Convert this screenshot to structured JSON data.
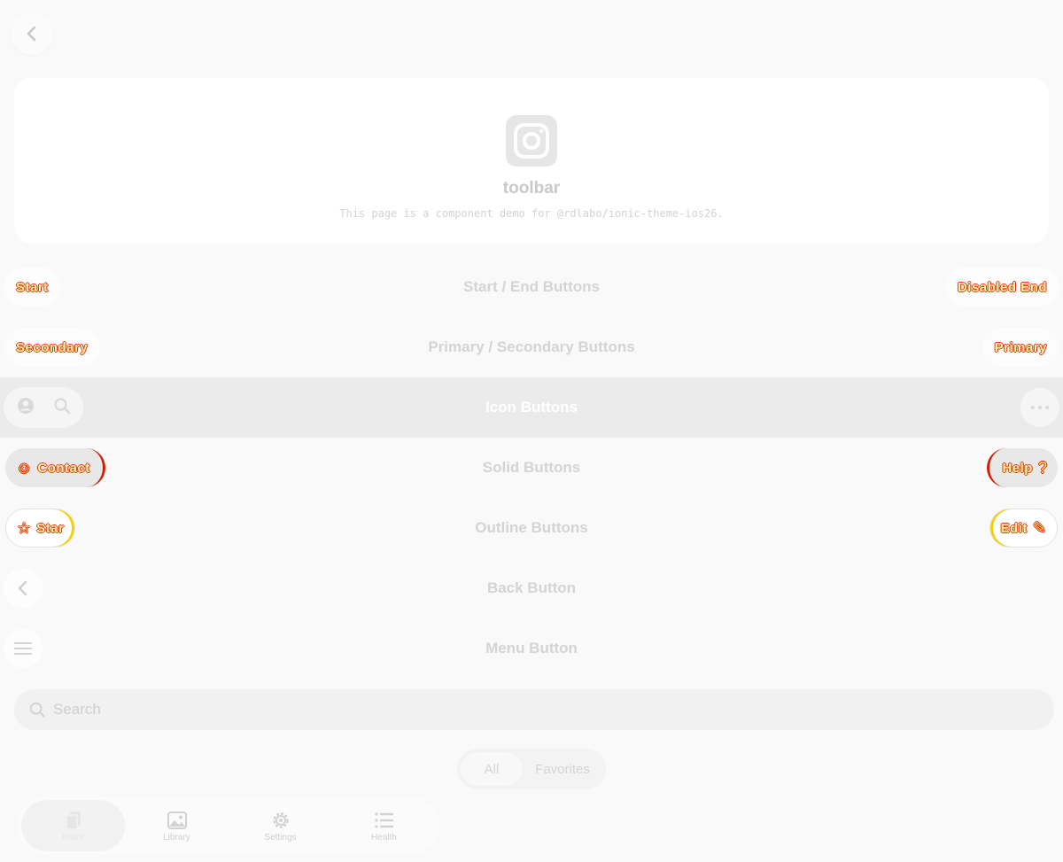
{
  "header": {
    "back_icon": "chevron-left-icon"
  },
  "hero": {
    "title": "toolbar",
    "subtitle": "This page is a component demo for @rdlabo/ionic-theme-ios26."
  },
  "toolbars": {
    "start_end": {
      "title": "Start / End Buttons",
      "start_label": "Start",
      "end_label": "Disabled End"
    },
    "primary_secondary": {
      "title": "Primary / Secondary Buttons",
      "secondary_label": "Secondary",
      "primary_label": "Primary"
    },
    "icon": {
      "title": "Icon Buttons",
      "icons": [
        "person-circle-icon",
        "search-icon",
        "ellipsis-icon"
      ]
    },
    "solid": {
      "title": "Solid Buttons",
      "start_label": "Contact",
      "end_label": "Help"
    },
    "outline": {
      "title": "Outline Buttons",
      "start_label": "Star",
      "end_label": "Edit"
    },
    "back": {
      "title": "Back Button"
    },
    "menu": {
      "title": "Menu Button"
    }
  },
  "search": {
    "placeholder": "Search"
  },
  "segment": {
    "items": [
      "All",
      "Favorites"
    ],
    "selected": "All"
  },
  "tabbar": {
    "items": [
      {
        "label": "Index",
        "icon": "documents-icon"
      },
      {
        "label": "Library",
        "icon": "images-icon"
      },
      {
        "label": "Settings",
        "icon": "gear-icon"
      },
      {
        "label": "Health",
        "icon": "list-icon"
      }
    ],
    "selected": "Index"
  },
  "colors": {
    "accent_red": "#d41c00",
    "accent_yellow": "#f5d000",
    "muted": "#d4d4d4"
  }
}
